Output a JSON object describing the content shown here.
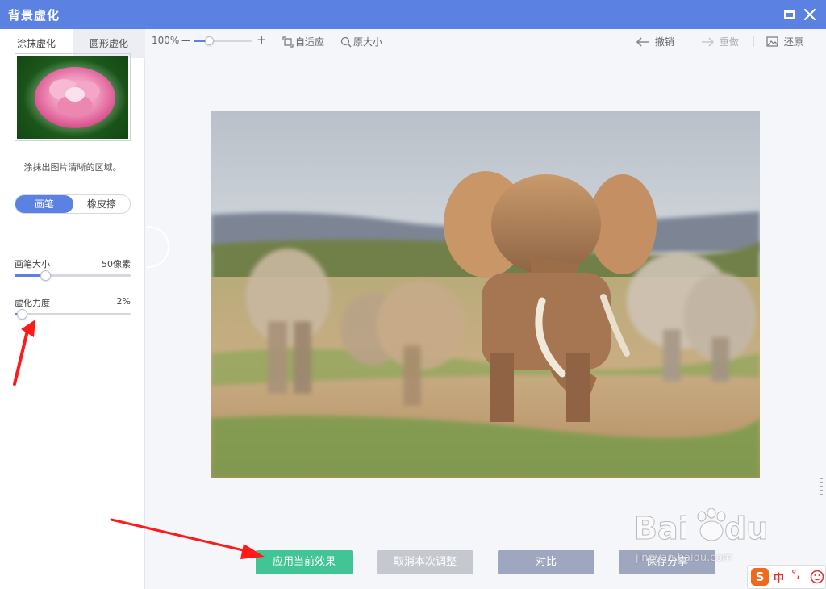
{
  "window": {
    "title": "背景虚化"
  },
  "tabs": [
    {
      "label": "涂抹虚化",
      "active": true
    },
    {
      "label": "圆形虚化",
      "active": false
    }
  ],
  "left": {
    "hint": "涂抹出图片清晰的区域。",
    "mode": {
      "brush": "画笔",
      "eraser": "橡皮擦",
      "selected": "画笔"
    },
    "brush_size": {
      "label": "画笔大小",
      "value_text": "50像素",
      "fraction": 0.22
    },
    "blur_strength": {
      "label": "虚化力度",
      "value_text": "2%",
      "fraction": 0.02
    }
  },
  "toolbar": {
    "zoom_text": "100%",
    "zoom_fraction": 0.2,
    "fit": "自适应",
    "original_size": "原大小",
    "undo": "撤销",
    "redo": "重做",
    "restore": "还原"
  },
  "buttons": {
    "apply": "应用当前效果",
    "cancel": "取消本次调整",
    "compare": "对比",
    "save": "保存分享"
  },
  "colors": {
    "accent": "#5b82e3",
    "apply": "#41c596",
    "muted_button": "#9fa6bf",
    "disabled_button": "#c6c8cf",
    "annotation_arrow": "#ff1a1a"
  },
  "watermark": {
    "text": "jingyan.baidu.com"
  },
  "ime": {
    "logo": "S",
    "lang": "中",
    "punctuation": "°,"
  }
}
